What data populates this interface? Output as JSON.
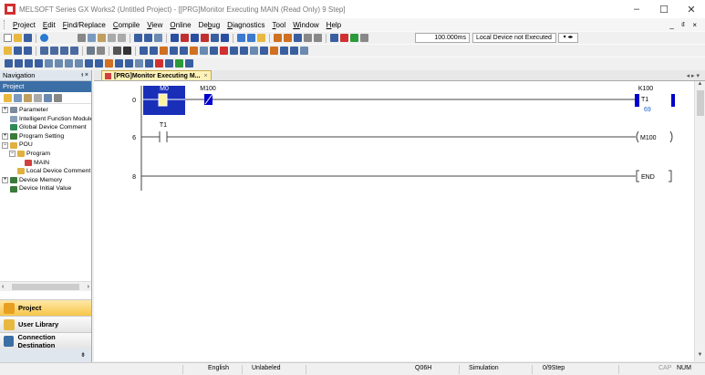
{
  "window": {
    "title": "MELSOFT Series GX Works2 (Untitled Project) - [[PRG]Monitor Executing MAIN (Read Only) 9 Step]",
    "minimize": "–",
    "maximize": "☐",
    "close": "✕"
  },
  "menu": {
    "items": [
      "Project",
      "Edit",
      "Find/Replace",
      "Compile",
      "View",
      "Online",
      "Debug",
      "Diagnostics",
      "Tool",
      "Window",
      "Help"
    ],
    "accelerators": [
      "P",
      "E",
      "F",
      "C",
      "V",
      "O",
      "b",
      "D",
      "T",
      "W",
      "H"
    ],
    "mdi_controls": "_ ₫ ×"
  },
  "toolbar": {
    "scan_time": "100.000ms",
    "device_status": "Local Device not Executed"
  },
  "navigation": {
    "title": "Navigation",
    "pin": "ᵻ ×",
    "section": "Project",
    "tree": [
      {
        "label": "Parameter",
        "level": 0,
        "expander": "+",
        "icon_color": "#7a8a9a"
      },
      {
        "label": "Intelligent Function Module",
        "level": 0,
        "expander": "",
        "icon_color": "#8aa0b8"
      },
      {
        "label": "Global Device Comment",
        "level": 0,
        "expander": "",
        "icon_color": "#2e8b57"
      },
      {
        "label": "Program Setting",
        "level": 0,
        "expander": "+",
        "icon_color": "#3a7a3a"
      },
      {
        "label": "POU",
        "level": 0,
        "expander": "−",
        "icon_color": "#e0b040"
      },
      {
        "label": "Program",
        "level": 1,
        "expander": "−",
        "icon_color": "#e0b040"
      },
      {
        "label": "MAIN",
        "level": 2,
        "expander": "",
        "icon_color": "#d04040"
      },
      {
        "label": "Local Device Comment",
        "level": 1,
        "expander": "",
        "icon_color": "#e0b040"
      },
      {
        "label": "Device Memory",
        "level": 0,
        "expander": "+",
        "icon_color": "#3a7a3a"
      },
      {
        "label": "Device Initial Value",
        "level": 0,
        "expander": "",
        "icon_color": "#3a7a3a"
      }
    ],
    "buttons": {
      "project": "Project",
      "user_library": "User Library",
      "connection": "Connection Destination"
    },
    "bottom_glyph": "⇟"
  },
  "editor": {
    "tab_label": "[PRG]Monitor Executing M...",
    "tab_close": "×",
    "tab_nav": "◂ ▸ ▾"
  },
  "ladder": {
    "rungs": [
      {
        "step": "0",
        "contact1": "M0",
        "contact2": "M100",
        "output": "T1",
        "timer_k": "K100",
        "timer_value": "69"
      },
      {
        "step": "6",
        "contact1": "T1",
        "output": "M100"
      },
      {
        "step": "8",
        "output": "END"
      }
    ]
  },
  "status": {
    "language": "English",
    "label": "Unlabeled",
    "cpu": "Q06H",
    "mode": "Simulation",
    "steps": "0/9Step",
    "cap": "CAP",
    "num": "NUM"
  },
  "colors": {
    "contact_active": "#0000cc",
    "monitor_highlight": "#1a2fb8",
    "nav_active": "#f7c64a"
  }
}
